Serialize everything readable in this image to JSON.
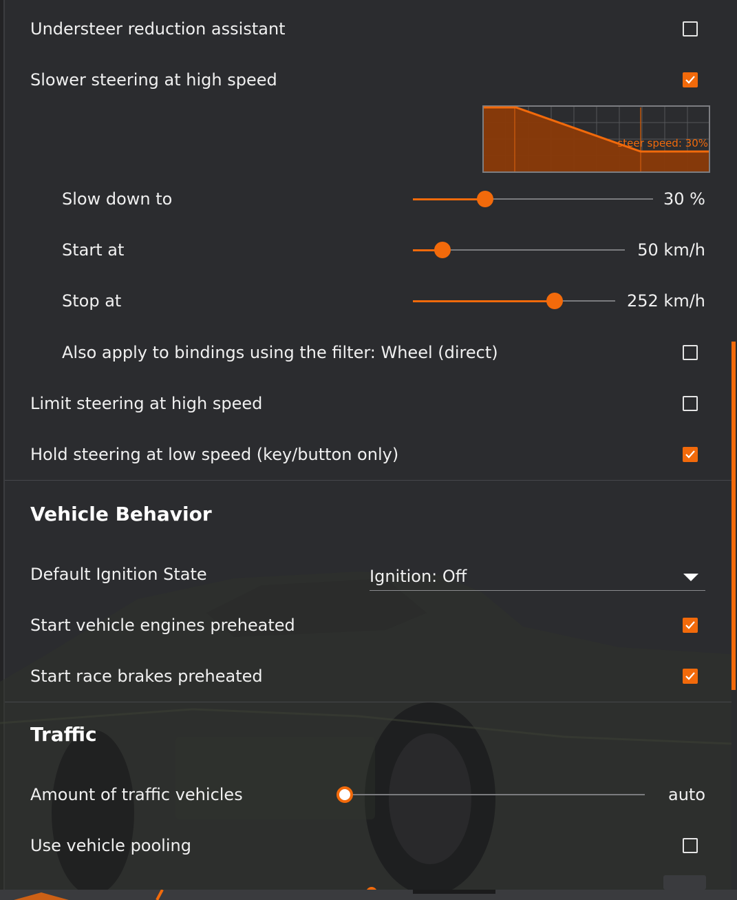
{
  "accent_color": "#f26a0b",
  "steering": {
    "understeer_reduction": {
      "label": "Understeer reduction assistant",
      "checked": false
    },
    "slower_steering": {
      "label": "Slower steering at high speed",
      "checked": true
    },
    "graph": {
      "label": "steer speed: 30%"
    },
    "slow_down_to": {
      "label": "Slow down to",
      "value_text": "30 %",
      "fraction": 0.3
    },
    "start_at": {
      "label": "Start at",
      "value_text": "50 km/h",
      "fraction": 0.14
    },
    "stop_at": {
      "label": "Stop at",
      "value_text": "252 km/h",
      "fraction": 0.7
    },
    "also_apply": {
      "label": "Also apply to bindings using the filter: Wheel (direct)",
      "checked": false
    },
    "limit_steering": {
      "label": "Limit steering at high speed",
      "checked": false
    },
    "hold_steering": {
      "label": "Hold steering at low speed (key/button only)",
      "checked": true
    }
  },
  "vehicle_behavior": {
    "title": "Vehicle Behavior",
    "ignition": {
      "label": "Default Ignition State",
      "selected": "Ignition: Off"
    },
    "engines_preheated": {
      "label": "Start vehicle engines preheated",
      "checked": true
    },
    "brakes_preheated": {
      "label": "Start race brakes preheated",
      "checked": true
    }
  },
  "traffic": {
    "title": "Traffic",
    "amount": {
      "label": "Amount of traffic vehicles",
      "value_text": "auto",
      "fraction": 0.0
    },
    "pooling": {
      "label": "Use vehicle pooling",
      "checked": false
    }
  }
}
